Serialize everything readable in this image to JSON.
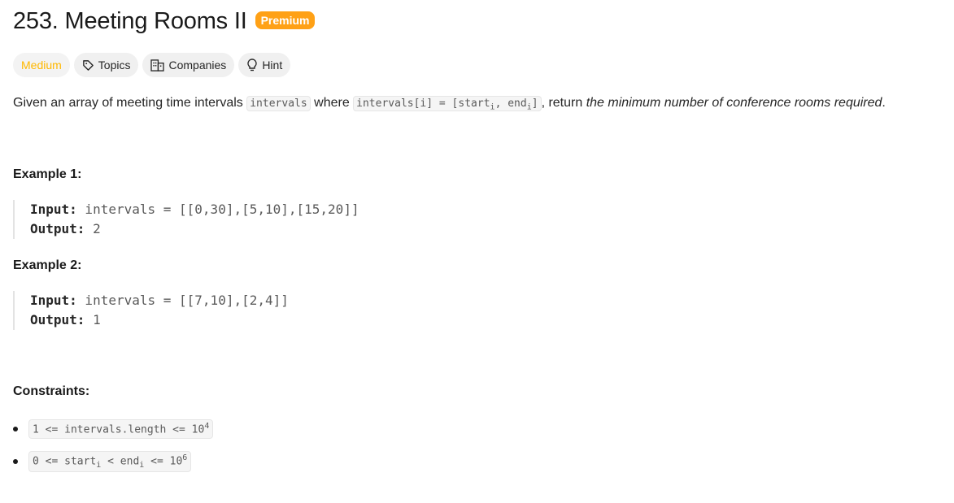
{
  "problem": {
    "title": "253. Meeting Rooms II",
    "premium_label": "Premium"
  },
  "tags": {
    "difficulty": "Medium",
    "topics": "Topics",
    "companies": "Companies",
    "hint": "Hint"
  },
  "description": {
    "part1": "Given an array of meeting time intervals ",
    "code1": "intervals",
    "part2": " where ",
    "code2_a": "intervals[i] = [start",
    "code2_sub1": "i",
    "code2_b": ", end",
    "code2_sub2": "i",
    "code2_c": "]",
    "part3": ", return ",
    "emphasis": "the minimum number of conference rooms required",
    "part4": "."
  },
  "examples": [
    {
      "title": "Example 1:",
      "input_label": "Input:",
      "input_value": " intervals = [[0,30],[5,10],[15,20]]",
      "output_label": "Output:",
      "output_value": " 2"
    },
    {
      "title": "Example 2:",
      "input_label": "Input:",
      "input_value": " intervals = [[7,10],[2,4]]",
      "output_label": "Output:",
      "output_value": " 1"
    }
  ],
  "constraints": {
    "title": "Constraints:",
    "c1_a": "1 <= intervals.length <= 10",
    "c1_sup": "4",
    "c2_a": "0 <= start",
    "c2_sub1": "i",
    "c2_b": " < end",
    "c2_sub2": "i",
    "c2_c": " <= 10",
    "c2_sup": "6"
  },
  "colors": {
    "premium": "#ffa116",
    "medium": "#ffb800",
    "tag_bg": "#f0f0f0"
  }
}
